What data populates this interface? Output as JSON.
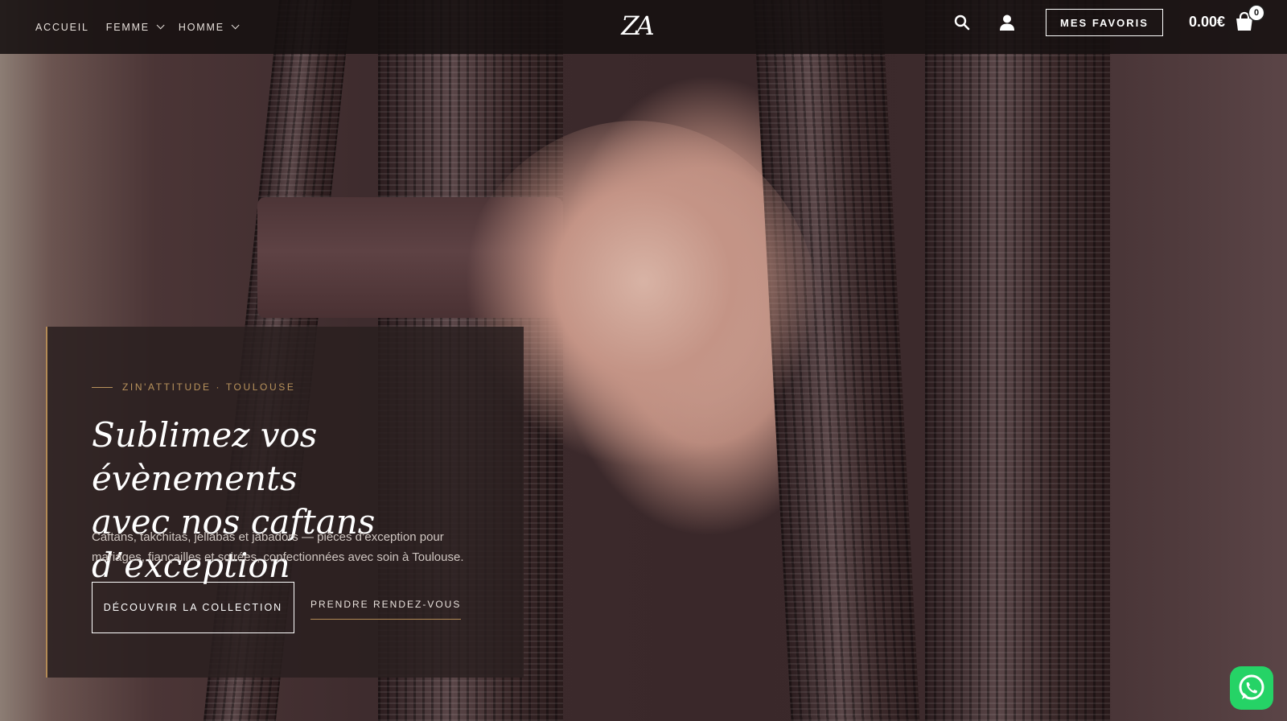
{
  "nav": {
    "items": [
      {
        "label": "ACCUEIL",
        "has_dropdown": false
      },
      {
        "label": "FEMME",
        "has_dropdown": true
      },
      {
        "label": "HOMME",
        "has_dropdown": true
      }
    ],
    "logo_text": "ZA",
    "icons": {
      "search": "search-icon",
      "account": "user-icon",
      "cart": "shopping-bag-icon"
    },
    "favoris_label": "MES FAVORIS",
    "cart_total": "0.00€",
    "cart_count": "0"
  },
  "hero": {
    "eyebrow": "ZIN'ATTITUDE · TOULOUSE",
    "headline_line1": "Sublimez vos évènements",
    "headline_line2": "avec nos caftans d’exception",
    "description": "Caftans, takchitas, jellabas et jabadors — pièces d’exception pour mariages, fiançailles et soirées, confectionnées avec soin à Toulouse.",
    "primary_cta": "DÉCOUVRIR LA COLLECTION",
    "secondary_cta": "PRENDRE RENDEZ-VOUS"
  },
  "floating": {
    "whatsapp_icon": "whatsapp-icon"
  },
  "colors": {
    "accent_gold": "#b9935c",
    "whatsapp_green": "#25d366",
    "card_bg": "#2a2020"
  }
}
